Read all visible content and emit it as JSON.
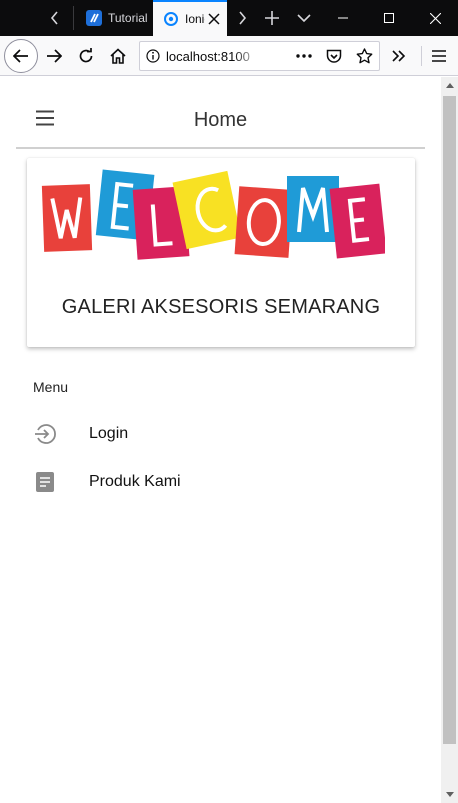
{
  "browser": {
    "tabs": [
      {
        "title": "Tutorial",
        "favicon": "codepolitan-icon",
        "active": false
      },
      {
        "title": "Ionic App",
        "favicon": "loading-circle-icon",
        "active": true
      }
    ],
    "url": "localhost:8100",
    "accent_color": "#0a84ff"
  },
  "app": {
    "header_title": "Home",
    "menu_icon": "hamburger-menu-icon",
    "welcome_letters": [
      "W",
      "E",
      "L",
      "C",
      "O",
      "M",
      "E"
    ],
    "welcome_colors": [
      "#e8413b",
      "#1f9bd7",
      "#d9225c",
      "#f8e123",
      "#e8413b",
      "#1f9bd7",
      "#d9225c"
    ],
    "card_title": "GALERI AKSESORIS SEMARANG",
    "menu_header": "Menu",
    "menu_items": [
      {
        "label": "Login",
        "icon": "log-in-icon"
      },
      {
        "label": "Produk Kami",
        "icon": "document-icon"
      }
    ]
  }
}
